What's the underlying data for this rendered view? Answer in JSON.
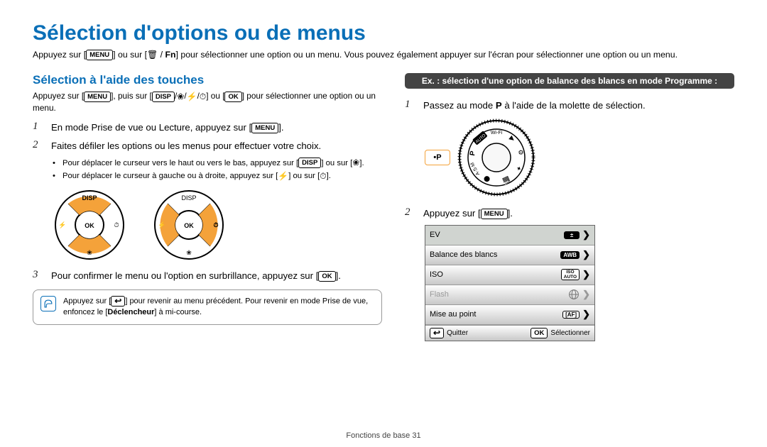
{
  "page": {
    "title": "Sélection d'options ou de menus",
    "intro_1": "Appuyez sur [",
    "intro_menu": "MENU",
    "intro_2": "] ou sur [",
    "intro_trash": "🗑",
    "intro_slash": " / ",
    "intro_fn": "Fn",
    "intro_3": "] pour sélectionner une option ou un menu. Vous pouvez également appuyer sur l'écran pour sélectionner une option ou un menu."
  },
  "left": {
    "heading": "Sélection à l'aide des touches",
    "intro_a": "Appuyez sur [",
    "intro_b": "], puis sur [",
    "intro_c": "] ou [",
    "intro_d": "] pour sélectionner une option ou un menu.",
    "step1_a": "En mode Prise de vue ou Lecture, appuyez sur [",
    "step1_b": "].",
    "step2": "Faites défiler les options ou les menus pour effectuer votre choix.",
    "bullet1_a": "Pour déplacer le curseur vers le haut ou vers le bas, appuyez sur [",
    "bullet1_b": "] ou sur [",
    "bullet1_c": "].",
    "bullet2_a": "Pour déplacer le curseur à gauche ou à droite, appuyez sur [",
    "bullet2_b": "] ou sur [",
    "bullet2_c": "].",
    "step3_a": "Pour confirmer le menu ou l'option en surbrillance, appuyez sur [",
    "step3_b": "].",
    "note_a": "Appuyez sur [",
    "note_back": "↩",
    "note_b": "] pour revenir au menu précédent. Pour revenir en mode Prise de vue, enfoncez le [",
    "note_bold": "Déclencheur",
    "note_c": "] à mi-course."
  },
  "labels": {
    "menu": "MENU",
    "disp": "DISP",
    "ok": "OK",
    "flower": "❀",
    "flash": "⚡",
    "timer": "⏱"
  },
  "right": {
    "banner": "Ex. : sélection d'une option de balance des blancs en mode Programme :",
    "step1_a": "Passez au mode ",
    "step1_p": "P",
    "step1_b": " à l'aide de la molette de sélection.",
    "step2_a": "Appuyez sur [",
    "step2_b": "].",
    "p_indicator": "P"
  },
  "dial_modes": {
    "wifi": "Wi-Fi",
    "auto": "AUTO",
    "asm": "A·S·M"
  },
  "menu": {
    "ev": "EV",
    "wb": "Balance des blancs",
    "iso": "ISO",
    "flash": "Flash",
    "focus": "Mise au point",
    "quit": "Quitter",
    "select": "Sélectionner",
    "val_ev": "±",
    "val_awb": "AWB",
    "val_iso": "ISO\nAUTO",
    "val_af": "AF"
  },
  "footer": "Fonctions de base  31"
}
